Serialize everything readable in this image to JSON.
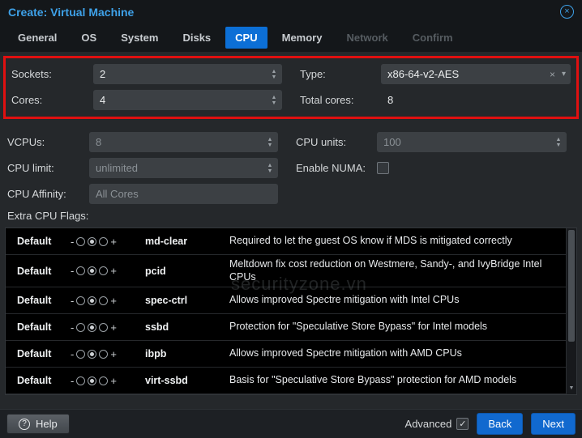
{
  "window": {
    "title": "Create: Virtual Machine"
  },
  "tabs": [
    {
      "label": "General",
      "state": "normal"
    },
    {
      "label": "OS",
      "state": "normal"
    },
    {
      "label": "System",
      "state": "normal"
    },
    {
      "label": "Disks",
      "state": "normal"
    },
    {
      "label": "CPU",
      "state": "active"
    },
    {
      "label": "Memory",
      "state": "normal"
    },
    {
      "label": "Network",
      "state": "disabled"
    },
    {
      "label": "Confirm",
      "state": "disabled"
    }
  ],
  "form": {
    "sockets": {
      "label": "Sockets:",
      "value": "2"
    },
    "cores": {
      "label": "Cores:",
      "value": "4"
    },
    "type": {
      "label": "Type:",
      "value": "x86-64-v2-AES"
    },
    "total_cores": {
      "label": "Total cores:",
      "value": "8"
    },
    "vcpus": {
      "label": "VCPUs:",
      "value": "8",
      "disabled": true
    },
    "cpu_limit": {
      "label": "CPU limit:",
      "value": "unlimited",
      "disabled": true
    },
    "cpu_affinity": {
      "label": "CPU Affinity:",
      "value": "All Cores",
      "disabled": true
    },
    "cpu_units": {
      "label": "CPU units:",
      "value": "100"
    },
    "enable_numa": {
      "label": "Enable NUMA:",
      "checked": false
    }
  },
  "flags": {
    "section_label": "Extra CPU Flags:",
    "rows": [
      {
        "state": "Default",
        "flag": "md-clear",
        "description": "Required to let the guest OS know if MDS is mitigated correctly"
      },
      {
        "state": "Default",
        "flag": "pcid",
        "description": "Meltdown fix cost reduction on Westmere, Sandy-, and IvyBridge Intel CPUs"
      },
      {
        "state": "Default",
        "flag": "spec-ctrl",
        "description": "Allows improved Spectre mitigation with Intel CPUs"
      },
      {
        "state": "Default",
        "flag": "ssbd",
        "description": "Protection for \"Speculative Store Bypass\" for Intel models"
      },
      {
        "state": "Default",
        "flag": "ibpb",
        "description": "Allows improved Spectre mitigation with AMD CPUs"
      },
      {
        "state": "Default",
        "flag": "virt-ssbd",
        "description": "Basis for \"Speculative Store Bypass\" protection for AMD models"
      }
    ]
  },
  "icons": {
    "close": "×",
    "clear": "×",
    "dropdown": "▾",
    "spin_up": "▲",
    "spin_down": "▼",
    "scroll_down": "▼",
    "minus": "-",
    "plus": "+",
    "check": "✓",
    "help": "?"
  },
  "watermark": "securityzone.vn",
  "footer": {
    "help_label": "Help",
    "advanced_label": "Advanced",
    "advanced_checked": true,
    "back_label": "Back",
    "next_label": "Next"
  },
  "colors": {
    "accent_blue": "#0c6fd6",
    "title_blue": "#3ea1e8",
    "highlight_red": "#e01010",
    "table_bg": "#000000"
  }
}
